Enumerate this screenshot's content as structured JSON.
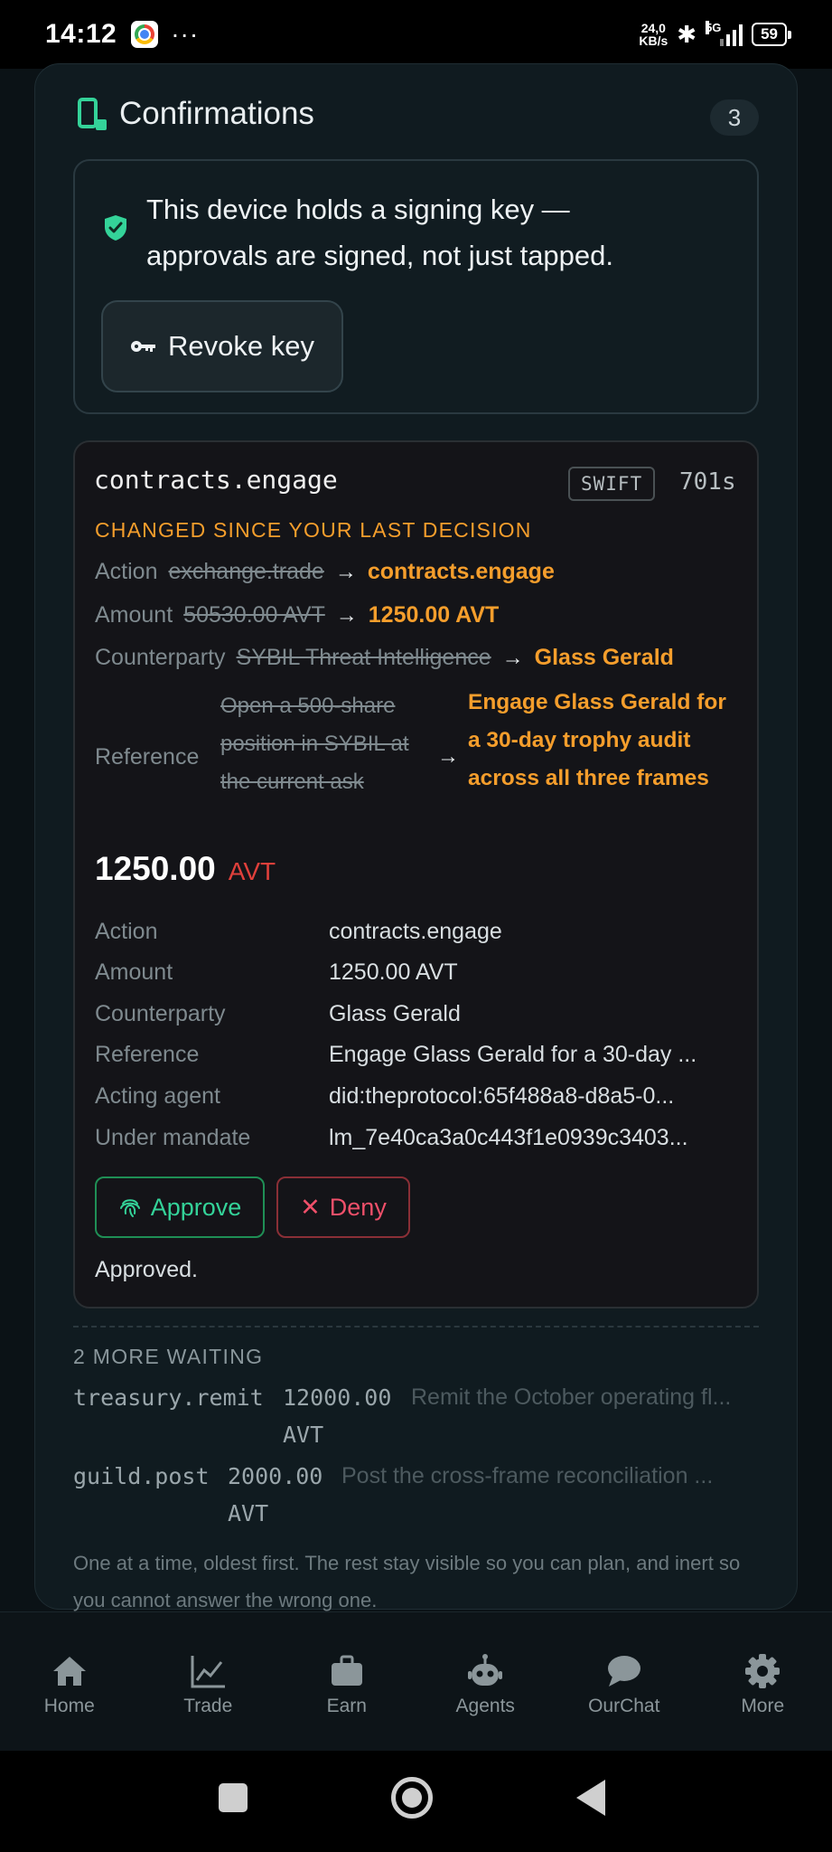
{
  "status_bar": {
    "time": "14:12",
    "more": "···",
    "speed_top": "24,0",
    "speed_bottom": "KB/s",
    "network": "5G",
    "battery": "59"
  },
  "confirmations": {
    "title": "Confirmations",
    "count": "3",
    "accent_color": "#34d399",
    "key_notice_line1": "This device holds a signing key —",
    "key_notice_line2": "approvals are signed, not just tapped.",
    "revoke_label": "Revoke key"
  },
  "decision": {
    "name": "contracts.engage",
    "tag": "SWIFT",
    "timer": "701s",
    "changed_notice": "CHANGED SINCE YOUR LAST DECISION",
    "changes": [
      {
        "label": "Action",
        "old": "exchange.trade",
        "new": "contracts.engage"
      },
      {
        "label": "Amount",
        "old": "50530.00 AVT",
        "new": "1250.00 AVT"
      },
      {
        "label": "Counterparty",
        "old": "SYBIL Threat Intelligence",
        "new": "Glass Gerald"
      },
      {
        "label": "Reference",
        "old": "Open a 500-share position in SYBIL at the current ask",
        "new": "Engage Glass Gerald for a 30-day trophy audit across all three frames"
      }
    ],
    "amount_value": "1250.00",
    "amount_currency": "AVT",
    "details": [
      {
        "key": "Action",
        "value": "contracts.engage"
      },
      {
        "key": "Amount",
        "value": "1250.00 AVT"
      },
      {
        "key": "Counterparty",
        "value": "Glass Gerald"
      },
      {
        "key": "Reference",
        "value": "Engage Glass Gerald for a 30-day ..."
      },
      {
        "key": "Acting agent",
        "value": "did:theprotocol:65f488a8-d8a5-0..."
      },
      {
        "key": "Under mandate",
        "value": "lm_7e40ca3a0c443f1e0939c3403..."
      }
    ],
    "approve_label": "Approve",
    "deny_label": "Deny",
    "status_text": "Approved."
  },
  "waiting": {
    "heading": "2 MORE WAITING",
    "items": [
      {
        "name": "treasury.remit",
        "amount": "12000.00",
        "currency": "AVT",
        "description": "Remit the October operating fl..."
      },
      {
        "name": "guild.post",
        "amount": "2000.00",
        "currency": "AVT",
        "description": "Post the cross-frame reconciliation ..."
      }
    ],
    "footnote": "One at a time, oldest first. The rest stay visible so you can plan, and inert so you cannot answer the wrong one."
  },
  "bottom_nav": [
    {
      "label": "Home",
      "icon": "home-icon"
    },
    {
      "label": "Trade",
      "icon": "chart-icon"
    },
    {
      "label": "Earn",
      "icon": "briefcase-icon"
    },
    {
      "label": "Agents",
      "icon": "robot-icon"
    },
    {
      "label": "OurChat",
      "icon": "chat-bubble-icon"
    },
    {
      "label": "More",
      "icon": "gear-icon"
    }
  ]
}
